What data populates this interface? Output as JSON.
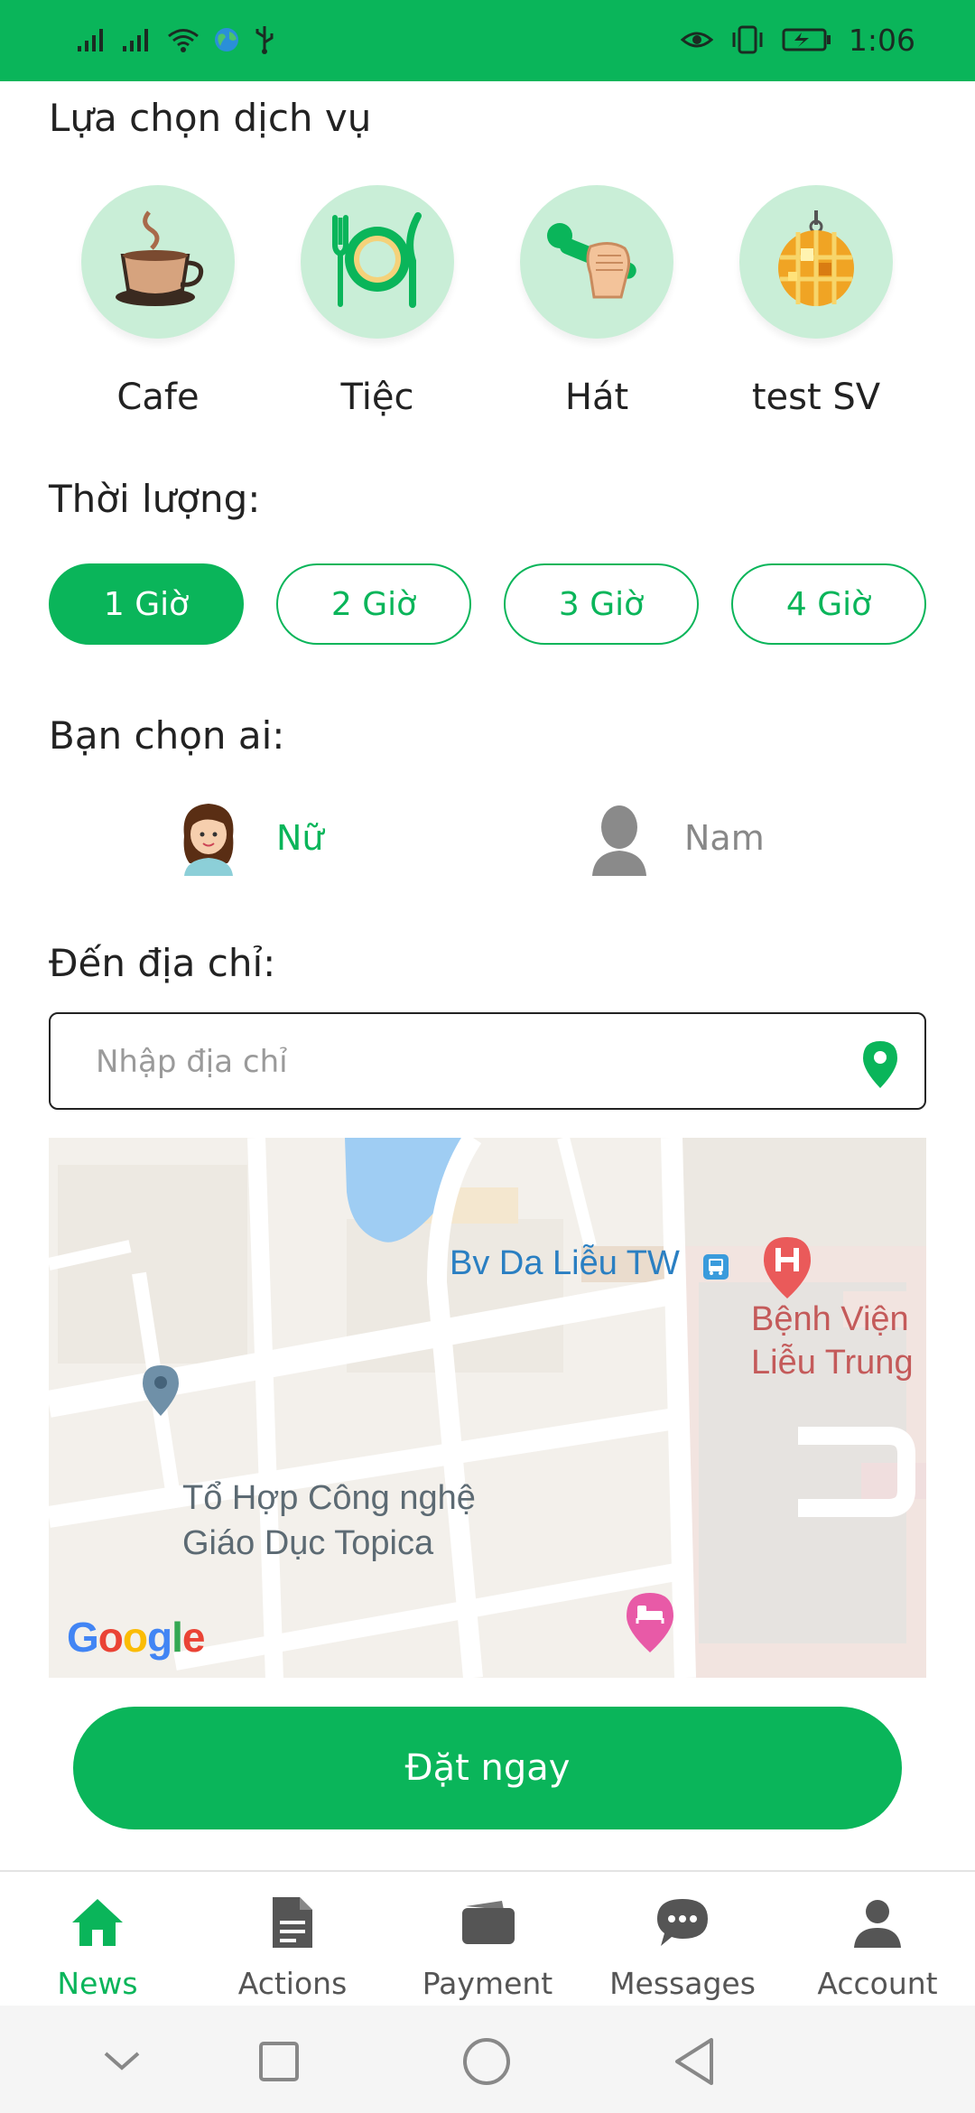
{
  "status_bar": {
    "time": "1:06"
  },
  "services": {
    "title": "Lựa chọn dịch vụ",
    "items": [
      {
        "label": "Cafe",
        "icon": "coffee-cup-icon"
      },
      {
        "label": "Tiệc",
        "icon": "plate-cutlery-icon"
      },
      {
        "label": "Hát",
        "icon": "microphone-hand-icon"
      },
      {
        "label": "test SV",
        "icon": "disco-ball-icon"
      }
    ]
  },
  "duration": {
    "title": "Thời lượng:",
    "options": [
      "1 Giờ",
      "2 Giờ",
      "3 Giờ",
      "4 Giờ"
    ],
    "selected": "1 Giờ"
  },
  "gender": {
    "title": "Bạn chọn ai:",
    "options": [
      {
        "label": "Nữ",
        "icon": "female-avatar-icon",
        "selected": true
      },
      {
        "label": "Nam",
        "icon": "male-silhouette-icon",
        "selected": false
      }
    ]
  },
  "address": {
    "title": "Đến địa chỉ:",
    "placeholder": "Nhập địa chỉ",
    "value": ""
  },
  "map": {
    "labels": {
      "bv_da_lieu": "Bv Da Liễu TW",
      "benh_vien_line1": "Bệnh Viện",
      "benh_vien_line2": "Liễu Trung",
      "topica_line1": "Tổ Hợp Công nghệ",
      "topica_line2": "Giáo Dục Topica"
    },
    "attribution": "Google"
  },
  "book_button": "Đặt ngay",
  "bottom_nav": [
    {
      "label": "News",
      "icon": "home-icon",
      "active": true
    },
    {
      "label": "Actions",
      "icon": "document-icon",
      "active": false
    },
    {
      "label": "Payment",
      "icon": "wallet-icon",
      "active": false
    },
    {
      "label": "Messages",
      "icon": "chat-bubble-icon",
      "active": false
    },
    {
      "label": "Account",
      "icon": "person-icon",
      "active": false
    }
  ],
  "colors": {
    "accent": "#0ab55a",
    "service_circle": "#c9eed7",
    "text": "#222222",
    "muted": "#777777"
  }
}
